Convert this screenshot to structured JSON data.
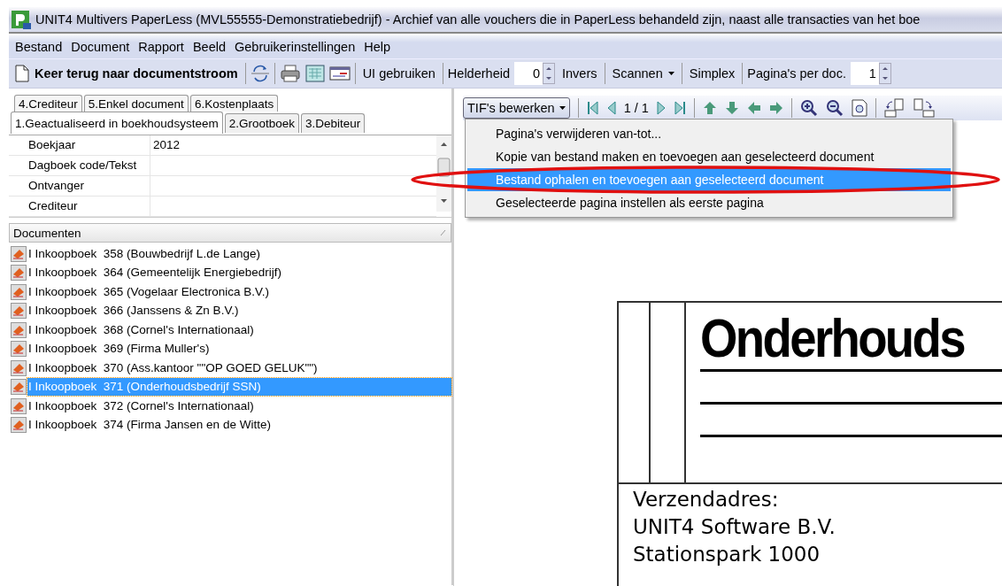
{
  "window": {
    "title": "UNIT4 Multivers PaperLess (MVL55555-Demonstratiebedrijf) - Archief van alle vouchers die in PaperLess behandeld zijn, naast alle transacties van het boe"
  },
  "menu": [
    "Bestand",
    "Document",
    "Rapport",
    "Beeld",
    "Gebruikerinstellingen",
    "Help"
  ],
  "toolbar": {
    "return_button": "Keer terug naar documentstroom",
    "ui_button": "UI gebruiken",
    "brightness_label": "Helderheid",
    "brightness_value": "0",
    "invert_button": "Invers",
    "scan_button": "Scannen",
    "simplex_button": "Simplex",
    "pages_label": "Pagina's per doc.",
    "pages_value": "1"
  },
  "tabs_back": [
    {
      "label": "4.Crediteur",
      "selected": false
    },
    {
      "label": "5.Enkel document",
      "selected": false
    },
    {
      "label": "6.Kostenplaats",
      "selected": false
    }
  ],
  "tabs_front": [
    {
      "label": "1.Geactualiseerd in boekhoudsysteem",
      "selected": true
    },
    {
      "label": "2.Grootboek",
      "selected": false
    },
    {
      "label": "3.Debiteur",
      "selected": false
    }
  ],
  "fields": [
    {
      "label": "Boekjaar",
      "value": "2012"
    },
    {
      "label": "Dagboek code/Tekst"
    },
    {
      "label": "Ontvanger"
    },
    {
      "label": "Crediteur"
    }
  ],
  "documents": {
    "header": "Documenten",
    "rows": [
      {
        "text": "I Inkoopboek  358 (Bouwbedrijf L.de Lange)",
        "selected": false
      },
      {
        "text": "I Inkoopboek  364 (Gemeentelijk Energiebedrijf)",
        "selected": false
      },
      {
        "text": "I Inkoopboek  365 (Vogelaar Electronica B.V.)",
        "selected": false
      },
      {
        "text": "I Inkoopboek  366 (Janssens & Zn B.V.)",
        "selected": false
      },
      {
        "text": "I Inkoopboek  368 (Cornel's Internationaal)",
        "selected": false
      },
      {
        "text": "I Inkoopboek  369 (Firma Muller's)",
        "selected": false
      },
      {
        "text": "I Inkoopboek  370 (Ass.kantoor \"\"OP GOED GELUK\"\")",
        "selected": false
      },
      {
        "text": "I Inkoopboek  371 (Onderhoudsbedrijf SSN)",
        "selected": true
      },
      {
        "text": "I Inkoopboek  372 (Cornel's Internationaal)",
        "selected": false
      },
      {
        "text": "I Inkoopboek  374 (Firma Jansen en de Witte)",
        "selected": false
      }
    ]
  },
  "viewer": {
    "edit_button": "TIF's bewerken",
    "page": "1 / 1",
    "menu": [
      {
        "label": "Pagina's verwijderen van-tot...",
        "selected": false
      },
      {
        "label": "Kopie van bestand maken en toevoegen aan geselecteerd document",
        "selected": false
      },
      {
        "label": "Bestand ophalen en toevoegen aan geselecteerd document",
        "selected": true
      },
      {
        "label": "Geselecteerde pagina instellen als eerste pagina",
        "selected": false
      }
    ],
    "document": {
      "heading": "Onderhouds",
      "address": [
        "Verzendadres:",
        "UNIT4 Software B.V.",
        "Stationspark 1000"
      ]
    }
  },
  "annotation": {
    "kind": "ellipse"
  }
}
